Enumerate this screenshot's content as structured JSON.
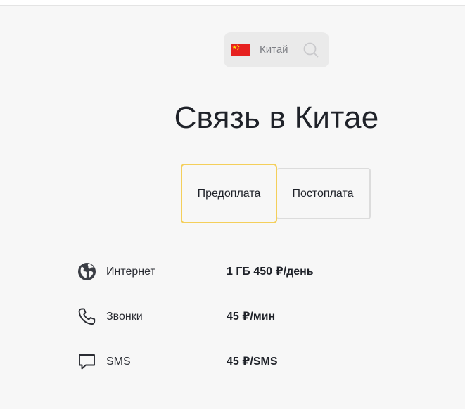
{
  "country_picker": {
    "country": "Китай",
    "flag_icon": "china-flag-icon",
    "search_icon": "search-icon"
  },
  "title": "Связь в Китае",
  "tabs": [
    {
      "label": "Предоплата",
      "selected": true
    },
    {
      "label": "Постоплата",
      "selected": false
    }
  ],
  "rates": [
    {
      "icon": "globe-icon",
      "label": "Интернет",
      "value": "1 ГБ 450 ₽/день"
    },
    {
      "icon": "phone-icon",
      "label": "Звонки",
      "value": "45 ₽/мин"
    },
    {
      "icon": "message-icon",
      "label": "SMS",
      "value": "45 ₽/SMS"
    }
  ],
  "colors": {
    "background": "#f7f7f7",
    "accent_border": "#f4cf5b",
    "flag_red": "#e6201f",
    "flag_yellow": "#ffde00"
  }
}
